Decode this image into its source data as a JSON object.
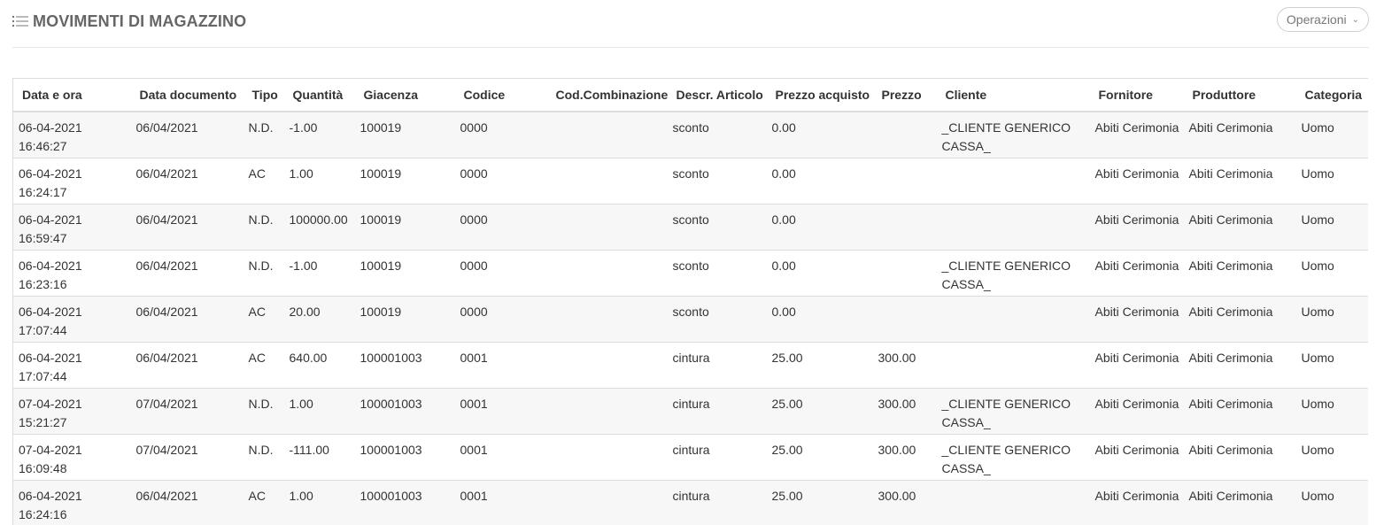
{
  "page": {
    "title": "MOVIMENTI DI MAGAZZINO",
    "operations_label": "Operazioni",
    "title_icon": "list-icon"
  },
  "table": {
    "columns": [
      "Data e ora",
      "Data documento",
      "Tipo",
      "Quantità",
      "Giacenza",
      "Codice",
      "Cod.Combinazione",
      "Descr. Articolo",
      "Prezzo acquisto",
      "Prezzo",
      "Cliente",
      "Fornitore",
      "Produttore",
      "Categoria"
    ],
    "rows": [
      [
        "06-04-2021 16:46:27",
        "06/04/2021",
        "N.D.",
        "-1.00",
        "100019",
        "0000",
        "",
        "sconto",
        "0.00",
        "",
        "_CLIENTE GENERICO CASSA_",
        "Abiti Cerimonia",
        "Abiti Cerimonia",
        "Uomo"
      ],
      [
        "06-04-2021 16:24:17",
        "06/04/2021",
        "AC",
        "1.00",
        "100019",
        "0000",
        "",
        "sconto",
        "0.00",
        "",
        "",
        "Abiti Cerimonia",
        "Abiti Cerimonia",
        "Uomo"
      ],
      [
        "06-04-2021 16:59:47",
        "06/04/2021",
        "N.D.",
        "100000.00",
        "100019",
        "0000",
        "",
        "sconto",
        "0.00",
        "",
        "",
        "Abiti Cerimonia",
        "Abiti Cerimonia",
        "Uomo"
      ],
      [
        "06-04-2021 16:23:16",
        "06/04/2021",
        "N.D.",
        "-1.00",
        "100019",
        "0000",
        "",
        "sconto",
        "0.00",
        "",
        "_CLIENTE GENERICO CASSA_",
        "Abiti Cerimonia",
        "Abiti Cerimonia",
        "Uomo"
      ],
      [
        "06-04-2021 17:07:44",
        "06/04/2021",
        "AC",
        "20.00",
        "100019",
        "0000",
        "",
        "sconto",
        "0.00",
        "",
        "",
        "Abiti Cerimonia",
        "Abiti Cerimonia",
        "Uomo"
      ],
      [
        "06-04-2021 17:07:44",
        "06/04/2021",
        "AC",
        "640.00",
        "100001003",
        "0001",
        "",
        "cintura",
        "25.00",
        "300.00",
        "",
        "Abiti Cerimonia",
        "Abiti Cerimonia",
        "Uomo"
      ],
      [
        "07-04-2021 15:21:27",
        "07/04/2021",
        "N.D.",
        "1.00",
        "100001003",
        "0001",
        "",
        "cintura",
        "25.00",
        "300.00",
        "_CLIENTE GENERICO CASSA_",
        "Abiti Cerimonia",
        "Abiti Cerimonia",
        "Uomo"
      ],
      [
        "07-04-2021 16:09:48",
        "07/04/2021",
        "N.D.",
        "-111.00",
        "100001003",
        "0001",
        "",
        "cintura",
        "25.00",
        "300.00",
        "_CLIENTE GENERICO CASSA_",
        "Abiti Cerimonia",
        "Abiti Cerimonia",
        "Uomo"
      ],
      [
        "06-04-2021 16:24:16",
        "06/04/2021",
        "AC",
        "1.00",
        "100001003",
        "0001",
        "",
        "cintura",
        "25.00",
        "300.00",
        "",
        "Abiti Cerimonia",
        "Abiti Cerimonia",
        "Uomo"
      ]
    ]
  }
}
